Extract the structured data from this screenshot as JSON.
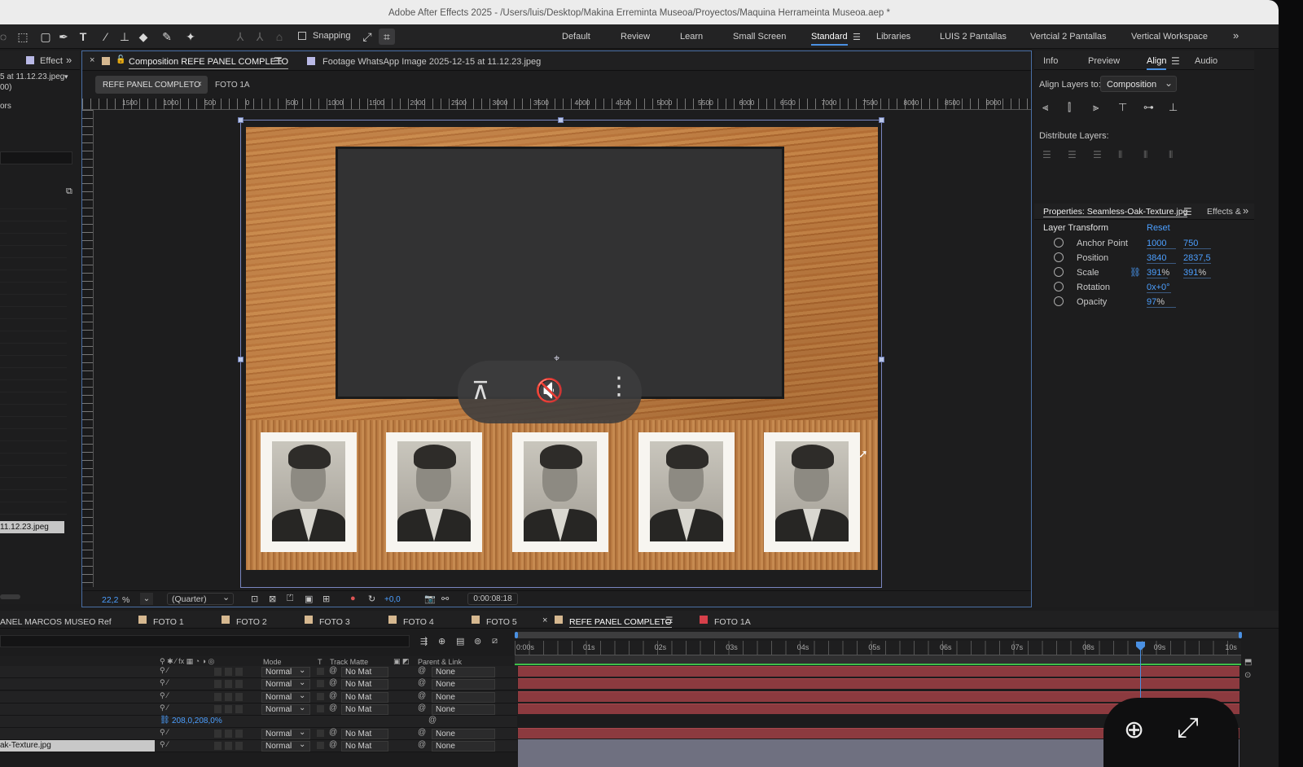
{
  "app": {
    "title": "Adobe After Effects 2025 - /Users/luis/Desktop/Makina Erreminta Museoa/Proyectos/Maquina Herrameinta Museoa.aep *"
  },
  "toolbar": {
    "snapping_label": "Snapping"
  },
  "workspaces": [
    "Default",
    "Review",
    "Learn",
    "Small Screen",
    "Standard",
    "Libraries",
    "LUIS 2 Pantallas",
    "Vertcial 2 Pantallas",
    "Vertical Workspace"
  ],
  "left_panel": {
    "tab": "Effect",
    "file_line1": "5 at 11.12.23.jpeg",
    "file_line2": "00)",
    "label_ors": "ors",
    "selected_item": "11.12.23.jpeg"
  },
  "comp_panel": {
    "tab_comp": "Composition REFE PANEL COMPLETO",
    "tab_footage": "Footage WhatsApp Image 2025-12-15 at 11.12.23.jpeg",
    "breadcrumb_active": "REFE PANEL COMPLETO",
    "breadcrumb_next": "FOTO 1A",
    "ruler_labels": [
      "1500",
      "1000",
      "500",
      "0",
      "500",
      "1000",
      "1500",
      "2000",
      "2500",
      "3000",
      "3500",
      "4000",
      "4500",
      "5000",
      "5500",
      "6000",
      "6500",
      "7000",
      "7500",
      "8000",
      "8500",
      "9000"
    ],
    "zoom": "22,2",
    "zoom_unit": "%",
    "resolution": "(Quarter)",
    "exposure": "+0,0",
    "timecode": "0:00:08:18"
  },
  "right_panel": {
    "tabs": [
      "Info",
      "Preview",
      "Align",
      "Audio"
    ],
    "active_tab": "Align",
    "align_layers_to_label": "Align Layers to:",
    "align_layers_to_value": "Composition",
    "distribute_label": "Distribute Layers:",
    "props_title": "Properties: Seamless-Oak-Texture.jpg",
    "props_tab2": "Effects &",
    "layer_transform": "Layer Transform",
    "reset": "Reset",
    "props": [
      {
        "name": "Anchor Point",
        "v1": "1000",
        "v2": "750"
      },
      {
        "name": "Position",
        "v1": "3840",
        "v2": "2837,5"
      },
      {
        "name": "Scale",
        "v1": "391",
        "u1": "%",
        "v2": "391",
        "u2": "%"
      },
      {
        "name": "Rotation",
        "v1": "0x",
        "v2": "+0°"
      },
      {
        "name": "Opacity",
        "v1": "97",
        "u1": "%"
      }
    ]
  },
  "timeline": {
    "tabs": [
      "ANEL MARCOS MUSEO Ref",
      "FOTO 1",
      "FOTO 2",
      "FOTO 3",
      "FOTO 4",
      "FOTO 5",
      "REFE PANEL COMPLETO",
      "FOTO 1A"
    ],
    "active_tab": "REFE PANEL COMPLETO",
    "col_mode": "Mode",
    "col_t": "T",
    "col_track": "Track Matte",
    "col_parent": "Parent & Link",
    "ticks": [
      "0:00s",
      "01s",
      "02s",
      "03s",
      "04s",
      "05s",
      "06s",
      "07s",
      "08s",
      "09s",
      "10s"
    ],
    "rows": [
      {
        "mode": "Normal",
        "matte": "No Mat",
        "parent": "None"
      },
      {
        "mode": "Normal",
        "matte": "No Mat",
        "parent": "None"
      },
      {
        "mode": "Normal",
        "matte": "No Mat",
        "parent": "None"
      },
      {
        "mode": "Normal",
        "matte": "No Mat",
        "parent": "None"
      }
    ],
    "scale_row": "208,0,208,0%",
    "rows2": [
      {
        "mode": "Normal",
        "matte": "No Mat",
        "parent": "None"
      },
      {
        "mode": "Normal",
        "matte": "No Mat",
        "parent": "None"
      }
    ],
    "layer_name": "ak-Texture.jpg"
  },
  "colors": {
    "accent": "#4a90e2",
    "wood": "#b8743c",
    "bar": "#8c3a3f",
    "screen": "#323233"
  }
}
